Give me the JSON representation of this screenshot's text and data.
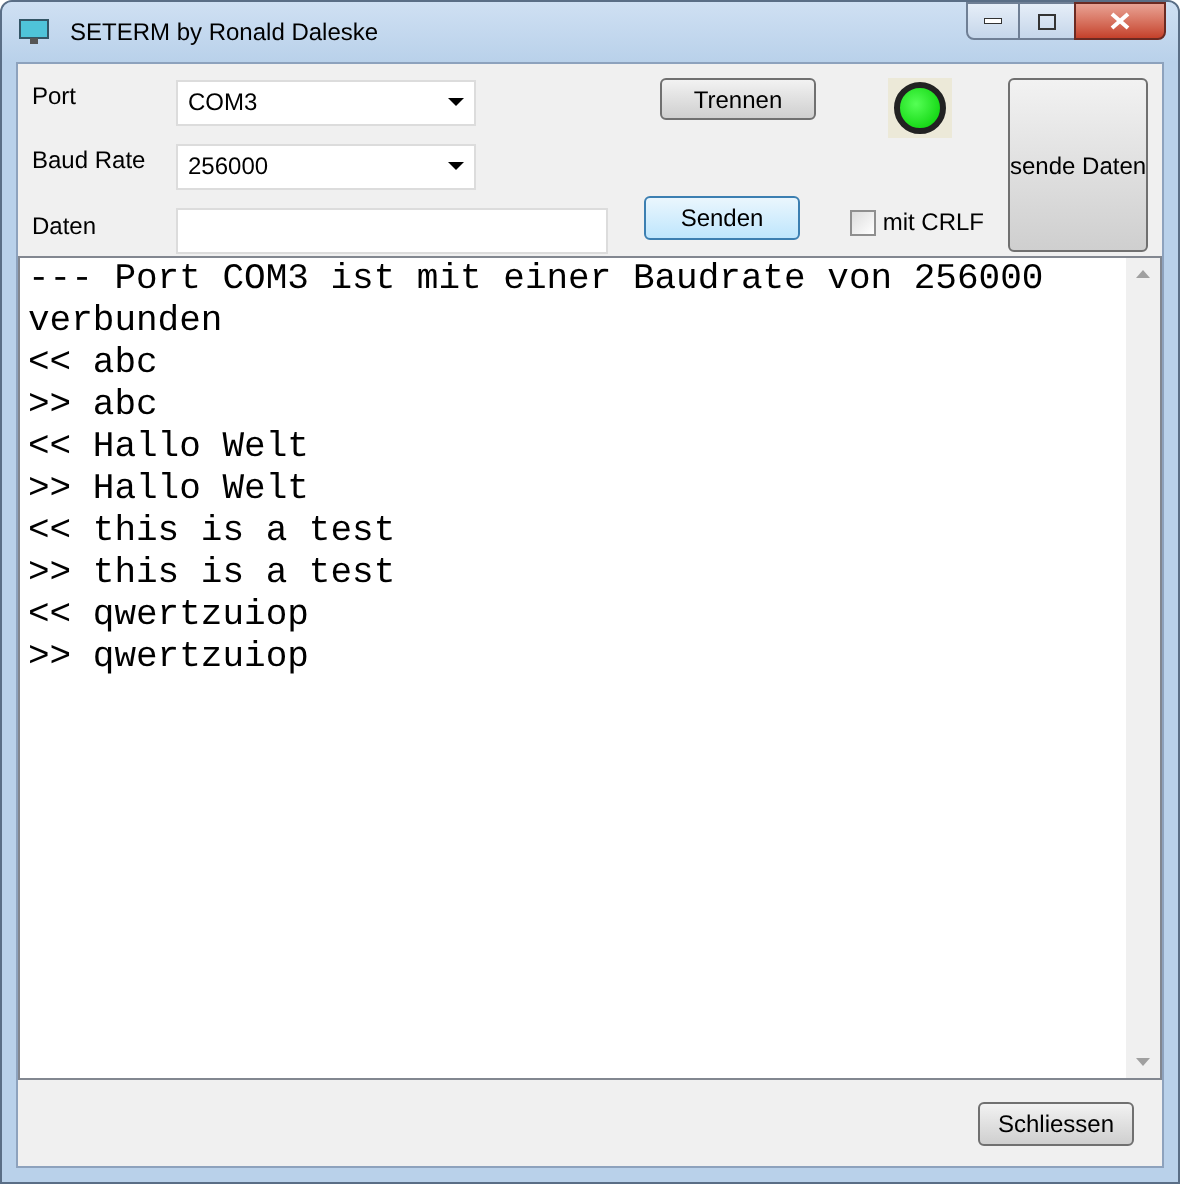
{
  "window": {
    "title": "SETERM by Ronald Daleske"
  },
  "form": {
    "port": {
      "label": "Port",
      "value": "COM3"
    },
    "baud_rate": {
      "label": "Baud Rate",
      "value": "256000"
    },
    "data": {
      "label": "Daten"
    },
    "disconnect_button": "Trennen",
    "send_button": "Senden",
    "crlf": {
      "label": "mit CRLF",
      "checked": false
    },
    "status_led": {
      "on": true
    },
    "send_data_button": "sende Daten"
  },
  "terminal": {
    "lines": [
      "--- Port COM3 ist mit einer Baudrate von 256000 verbunden",
      "<< abc",
      ">> abc",
      "<< Hallo Welt",
      ">> Hallo Welt",
      "<< this is a test",
      ">> this is a test",
      "<< qwertzuiop",
      ">> qwertzuiop"
    ]
  },
  "footer": {
    "close_button": "Schliessen"
  }
}
